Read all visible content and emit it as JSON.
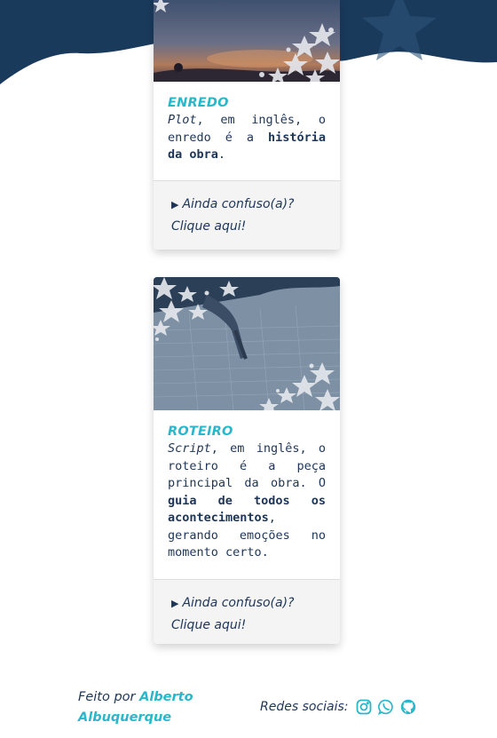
{
  "cards": [
    {
      "image_icon": "night-sky-illustration",
      "title": "ENREDO",
      "text": {
        "term": "Plot",
        "part1": ", em inglês, o enredo é a ",
        "highlight": "história da obra",
        "part2": "."
      },
      "toggle_label": "Ainda confuso(a)? Clique aqui!"
    },
    {
      "image_icon": "drawing-pen-illustration",
      "title": "ROTEIRO",
      "text": {
        "term": "Script",
        "part1": ", em inglês, o roteiro é a peça principal da obra. O ",
        "highlight": "guia de todos os acontecimentos",
        "part2": ", gerando emoções no momento certo."
      },
      "toggle_label": "Ainda confuso(a)? Clique aqui!"
    }
  ],
  "footer": {
    "credit_prefix": "Feito por ",
    "credit_name": "Alberto Albuquerque",
    "social_label": "Redes sociais:",
    "social_icons": [
      "instagram-icon",
      "whatsapp-icon",
      "github-icon"
    ]
  },
  "colors": {
    "navy": "#1d3557",
    "accent": "#2ab7ca",
    "footer_bg": "#f4f4f4"
  }
}
